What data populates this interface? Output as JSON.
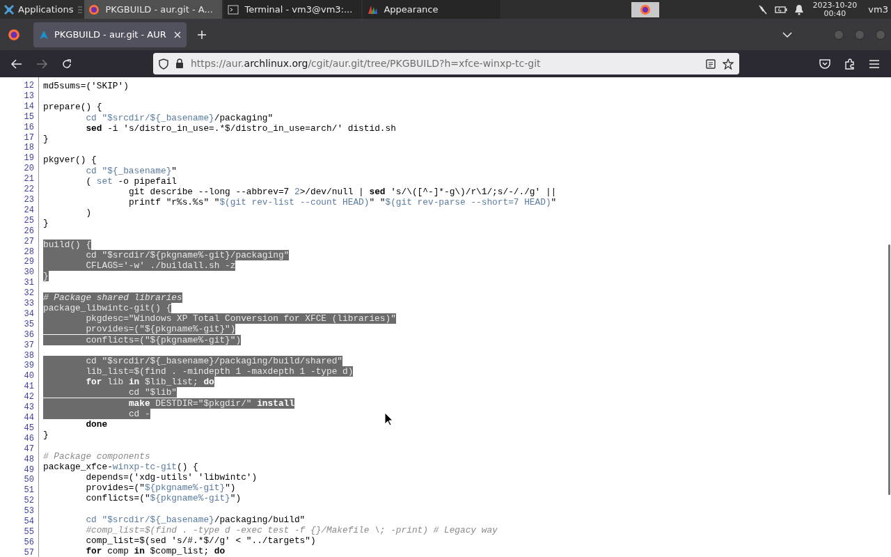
{
  "taskbar": {
    "apps_label": "Applications",
    "tasks": [
      {
        "label": "PKGBUILD - aur.git - A...",
        "kind": "browser",
        "selected": true
      },
      {
        "label": "Terminal - vm3@vm3:...",
        "kind": "terminal",
        "selected": false
      },
      {
        "label": "Appearance",
        "kind": "appearance",
        "selected": false
      }
    ],
    "date": "2023-10-20",
    "time": "00:40",
    "user": "vm3"
  },
  "browser": {
    "tab_title": "PKGBUILD - aur.git - AUR",
    "url_prefix": "https://aur.",
    "url_domain": "archlinux.org",
    "url_path": "/cgit/aur.git/tree/PKGBUILD?h=xfce-winxp-tc-git"
  },
  "line_numbers": [
    "12",
    "13",
    "14",
    "15",
    "16",
    "17",
    "18",
    "19",
    "20",
    "21",
    "22",
    "23",
    "24",
    "25",
    "26",
    "27",
    "28",
    "29",
    "30",
    "31",
    "32",
    "33",
    "34",
    "35",
    "36",
    "37",
    "38",
    "39",
    "40",
    "41",
    "42",
    "43",
    "44",
    "45",
    "46",
    "47",
    "48",
    "49",
    "50",
    "51",
    "52",
    "53",
    "54",
    "55",
    "56",
    "57"
  ],
  "code_lines": [
    {
      "kind": "code",
      "selected": false,
      "segments": [
        {
          "text": "md5sums=('SKIP')",
          "kind": "plain"
        }
      ]
    },
    {
      "kind": "blank"
    },
    {
      "kind": "code",
      "selected": false,
      "segments": [
        {
          "text": "prepare() {",
          "kind": "plain"
        }
      ]
    },
    {
      "kind": "code",
      "selected": false,
      "segments": [
        {
          "text": "\tcd \"$srcdir/${_basename}",
          "kind": "var"
        },
        {
          "text": "/packaging\"",
          "kind": "plain"
        }
      ]
    },
    {
      "kind": "code",
      "selected": false,
      "segments": [
        {
          "text": "\tsed",
          "kind": "keyword"
        },
        {
          "text": " -i 's/distro_in_use=.*$/distro_in_use=arch/' distid.sh",
          "kind": "plain"
        }
      ]
    },
    {
      "kind": "code",
      "selected": false,
      "segments": [
        {
          "text": "}",
          "kind": "plain"
        }
      ]
    },
    {
      "kind": "blank"
    },
    {
      "kind": "code",
      "selected": false,
      "segments": [
        {
          "text": "pkgver() {",
          "kind": "plain"
        }
      ]
    },
    {
      "kind": "code",
      "selected": false,
      "segments": [
        {
          "text": "\tcd \"${_basename}",
          "kind": "var"
        },
        {
          "text": "\"",
          "kind": "plain"
        }
      ]
    },
    {
      "kind": "code",
      "selected": false,
      "segments": [
        {
          "text": "\t( ",
          "kind": "plain"
        },
        {
          "text": "set",
          "kind": "var"
        },
        {
          "text": " -o pipefail",
          "kind": "plain"
        }
      ]
    },
    {
      "kind": "code",
      "selected": false,
      "segments": [
        {
          "text": "\t\tgit describe --long --abbrev=7 ",
          "kind": "plain"
        },
        {
          "text": "2",
          "kind": "var"
        },
        {
          "text": ">/dev/null | ",
          "kind": "plain"
        },
        {
          "text": "sed",
          "kind": "keyword"
        },
        {
          "text": " 's/\\([^-]*-g\\)/r\\1/;s/-/./g' ||",
          "kind": "plain"
        }
      ]
    },
    {
      "kind": "code",
      "selected": false,
      "segments": [
        {
          "text": "\t\tprintf \"r%s.%s\" \"",
          "kind": "plain"
        },
        {
          "text": "$(git rev-list --count HEAD)",
          "kind": "var"
        },
        {
          "text": "\" \"",
          "kind": "plain"
        },
        {
          "text": "$(git rev-parse --short=7 HEAD)",
          "kind": "var"
        },
        {
          "text": "\"",
          "kind": "plain"
        }
      ]
    },
    {
      "kind": "code",
      "selected": false,
      "segments": [
        {
          "text": "\t)",
          "kind": "plain"
        }
      ]
    },
    {
      "kind": "code",
      "selected": false,
      "segments": [
        {
          "text": "}",
          "kind": "plain"
        }
      ]
    },
    {
      "kind": "blank"
    },
    {
      "kind": "code",
      "selected": true,
      "segments": [
        {
          "text": "build() {",
          "kind": "plain"
        }
      ]
    },
    {
      "kind": "code",
      "selected": true,
      "segments": [
        {
          "text": "\tcd \"$srcdir/${pkgname%-git}/packaging\"",
          "kind": "plain"
        }
      ]
    },
    {
      "kind": "code",
      "selected": true,
      "segments": [
        {
          "text": "\tCFLAGS='-w' ./buildall.sh -z",
          "kind": "plain"
        }
      ]
    },
    {
      "kind": "code",
      "selected": true,
      "segments": [
        {
          "text": "}",
          "kind": "plain"
        }
      ]
    },
    {
      "kind": "blank"
    },
    {
      "kind": "code",
      "selected": true,
      "segments": [
        {
          "text": "# Package shared libraries",
          "kind": "comment"
        }
      ]
    },
    {
      "kind": "code",
      "selected": true,
      "segments": [
        {
          "text": "package_libwintc-git() {",
          "kind": "plain"
        }
      ]
    },
    {
      "kind": "code",
      "selected": true,
      "segments": [
        {
          "text": "\tpkgdesc=\"Windows XP Total Conversion for XFCE (libraries)\"",
          "kind": "plain"
        }
      ]
    },
    {
      "kind": "code",
      "selected": true,
      "segments": [
        {
          "text": "\tprovides=(\"${pkgname%-git}\")",
          "kind": "plain"
        }
      ]
    },
    {
      "kind": "code",
      "selected": true,
      "segments": [
        {
          "text": "\tconflicts=(\"${pkgname%-git}\")",
          "kind": "plain"
        }
      ]
    },
    {
      "kind": "blank"
    },
    {
      "kind": "code",
      "selected": true,
      "segments": [
        {
          "text": "\tcd \"$srcdir/${_basename}/packaging/build/shared\"",
          "kind": "plain"
        }
      ]
    },
    {
      "kind": "code",
      "selected": true,
      "segments": [
        {
          "text": "\tlib_list=$(find . -mindepth 1 -maxdepth 1 -type d)",
          "kind": "plain"
        }
      ]
    },
    {
      "kind": "code",
      "selected": true,
      "segments": [
        {
          "text": "\tfor",
          "kind": "keyword"
        },
        {
          "text": " lib ",
          "kind": "plain"
        },
        {
          "text": "in",
          "kind": "keyword"
        },
        {
          "text": " $lib_list; ",
          "kind": "plain"
        },
        {
          "text": "do",
          "kind": "keyword"
        }
      ]
    },
    {
      "kind": "code",
      "selected": true,
      "segments": [
        {
          "text": "\t\tcd \"$lib\"",
          "kind": "plain"
        }
      ]
    },
    {
      "kind": "code",
      "selected": true,
      "segments": [
        {
          "text": "\t\tmake",
          "kind": "keyword"
        },
        {
          "text": " DESTDIR=\"$pkgdir/\" ",
          "kind": "plain"
        },
        {
          "text": "install",
          "kind": "keyword"
        }
      ]
    },
    {
      "kind": "code",
      "selected": true,
      "segments": [
        {
          "text": "\t\tcd -",
          "kind": "plain"
        }
      ]
    },
    {
      "kind": "code",
      "selected": false,
      "segments": [
        {
          "text": "\tdone",
          "kind": "keyword"
        }
      ]
    },
    {
      "kind": "code",
      "selected": false,
      "segments": [
        {
          "text": "}",
          "kind": "plain"
        }
      ]
    },
    {
      "kind": "blank"
    },
    {
      "kind": "code",
      "selected": false,
      "segments": [
        {
          "text": "# Package components",
          "kind": "comment"
        }
      ]
    },
    {
      "kind": "code",
      "selected": false,
      "segments": [
        {
          "text": "package_xfce-",
          "kind": "plain"
        },
        {
          "text": "winxp-tc-git",
          "kind": "var"
        },
        {
          "text": "() {",
          "kind": "plain"
        }
      ]
    },
    {
      "kind": "code",
      "selected": false,
      "segments": [
        {
          "text": "\tdepends=('xdg-utils' 'libwintc')",
          "kind": "plain"
        }
      ]
    },
    {
      "kind": "code",
      "selected": false,
      "segments": [
        {
          "text": "\tprovides=(\"",
          "kind": "plain"
        },
        {
          "text": "${pkgname%-git}",
          "kind": "var"
        },
        {
          "text": "\")",
          "kind": "plain"
        }
      ]
    },
    {
      "kind": "code",
      "selected": false,
      "segments": [
        {
          "text": "\tconflicts=(\"",
          "kind": "plain"
        },
        {
          "text": "${pkgname%-git}",
          "kind": "var"
        },
        {
          "text": "\")",
          "kind": "plain"
        }
      ]
    },
    {
      "kind": "blank"
    },
    {
      "kind": "code",
      "selected": false,
      "segments": [
        {
          "text": "\tcd \"$srcdir/${_basename}",
          "kind": "var"
        },
        {
          "text": "/packaging/build\"",
          "kind": "plain"
        }
      ]
    },
    {
      "kind": "code",
      "selected": false,
      "segments": [
        {
          "text": "\t#comp_list=$(find . -type d -exec test -f {}/Makefile \\; -print) # Legacy way",
          "kind": "comment"
        }
      ]
    },
    {
      "kind": "code",
      "selected": false,
      "segments": [
        {
          "text": "\tcomp_list=$(sed 's/#.*$//g' < \"../targets\")",
          "kind": "plain"
        }
      ]
    },
    {
      "kind": "code",
      "selected": false,
      "segments": [
        {
          "text": "\tfor",
          "kind": "keyword"
        },
        {
          "text": " comp ",
          "kind": "plain"
        },
        {
          "text": "in",
          "kind": "keyword"
        },
        {
          "text": " $comp_list; ",
          "kind": "plain"
        },
        {
          "text": "do",
          "kind": "keyword"
        }
      ]
    }
  ]
}
